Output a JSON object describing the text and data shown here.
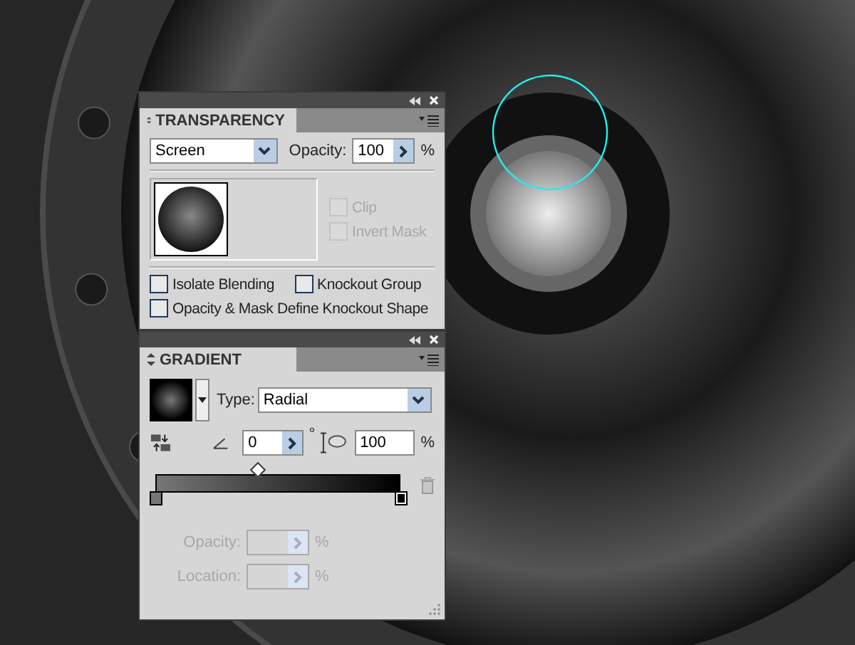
{
  "transparency": {
    "title": "TRANSPARENCY",
    "blend_mode": "Screen",
    "opacity_label": "Opacity:",
    "opacity": "100",
    "opacity_unit": "%",
    "mask_options": [
      {
        "label": "Clip",
        "checked": false,
        "disabled": true
      },
      {
        "label": "Invert Mask",
        "checked": false,
        "disabled": true
      }
    ],
    "options": [
      {
        "label": "Isolate Blending",
        "checked": false
      },
      {
        "label": "Knockout Group",
        "checked": false
      },
      {
        "label": "Opacity & Mask Define Knockout Shape",
        "checked": false
      }
    ]
  },
  "gradient": {
    "title": "GRADIENT",
    "type_label": "Type:",
    "type": "Radial",
    "angle": "0",
    "angle_unit": "°",
    "aspect": "100",
    "aspect_unit": "%",
    "midpoint": {
      "level": 0.42
    },
    "stops": [
      {
        "color": "#777777",
        "selected": false
      },
      {
        "color": "#000000",
        "selected": true
      }
    ],
    "stop_fields": [
      {
        "label": "Opacity:",
        "unit": "%",
        "disabled": true
      },
      {
        "label": "Location:",
        "unit": "%",
        "disabled": true
      }
    ]
  }
}
